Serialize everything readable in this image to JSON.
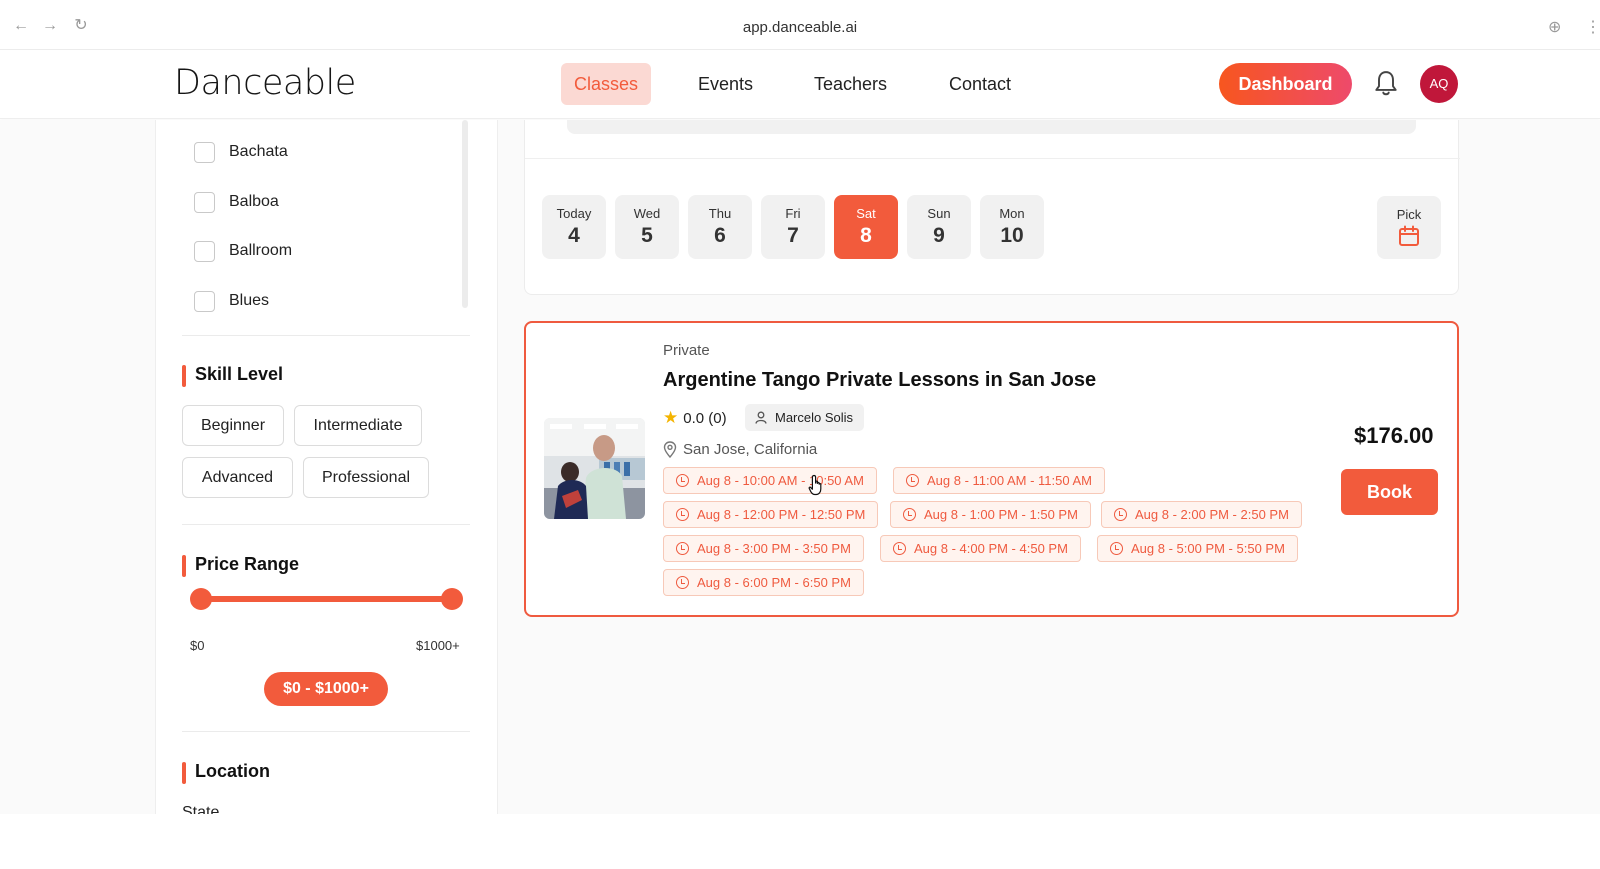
{
  "browser": {
    "url": "app.danceable.ai"
  },
  "header": {
    "logo": "Danceable",
    "nav": [
      {
        "label": "Classes",
        "active": true
      },
      {
        "label": "Events",
        "active": false
      },
      {
        "label": "Teachers",
        "active": false
      },
      {
        "label": "Contact",
        "active": false
      }
    ],
    "dashboard_label": "Dashboard",
    "avatar_initials": "AQ"
  },
  "sidebar": {
    "styles": [
      "Bachata",
      "Balboa",
      "Ballroom",
      "Blues"
    ],
    "skill_title": "Skill Level",
    "skills": [
      "Beginner",
      "Intermediate",
      "Advanced",
      "Professional"
    ],
    "price_title": "Price Range",
    "price_min_label": "$0",
    "price_max_label": "$1000+",
    "price_pill": "$0 - $1000+",
    "price_range_fraction": [
      0,
      1
    ],
    "location_title": "Location",
    "state_label": "State"
  },
  "dates": {
    "days": [
      {
        "name": "Today",
        "num": "4",
        "active": false
      },
      {
        "name": "Wed",
        "num": "5",
        "active": false
      },
      {
        "name": "Thu",
        "num": "6",
        "active": false
      },
      {
        "name": "Fri",
        "num": "7",
        "active": false
      },
      {
        "name": "Sat",
        "num": "8",
        "active": true
      },
      {
        "name": "Sun",
        "num": "9",
        "active": false
      },
      {
        "name": "Mon",
        "num": "10",
        "active": false
      }
    ],
    "pick_label": "Pick"
  },
  "class_card": {
    "category": "Private",
    "title": "Argentine Tango Private Lessons in San Jose",
    "rating": "0.0 (0)",
    "teacher": "Marcelo Solis",
    "location": "San Jose, California",
    "price": "$176.00",
    "book_label": "Book",
    "slots": [
      "Aug 8 - 10:00 AM - 10:50 AM",
      "Aug 8 - 11:00 AM - 11:50 AM",
      "Aug 8 - 12:00 PM - 12:50 PM",
      "Aug 8 - 1:00 PM - 1:50 PM",
      "Aug 8 - 2:00 PM - 2:50 PM",
      "Aug 8 - 3:00 PM - 3:50 PM",
      "Aug 8 - 4:00 PM - 4:50 PM",
      "Aug 8 - 5:00 PM - 5:50 PM",
      "Aug 8 - 6:00 PM - 6:50 PM"
    ]
  },
  "colors": {
    "accent": "#f25b3c",
    "accent_light": "#fbd9d3",
    "avatar_bg": "#c0173a",
    "star": "#f4b400"
  }
}
